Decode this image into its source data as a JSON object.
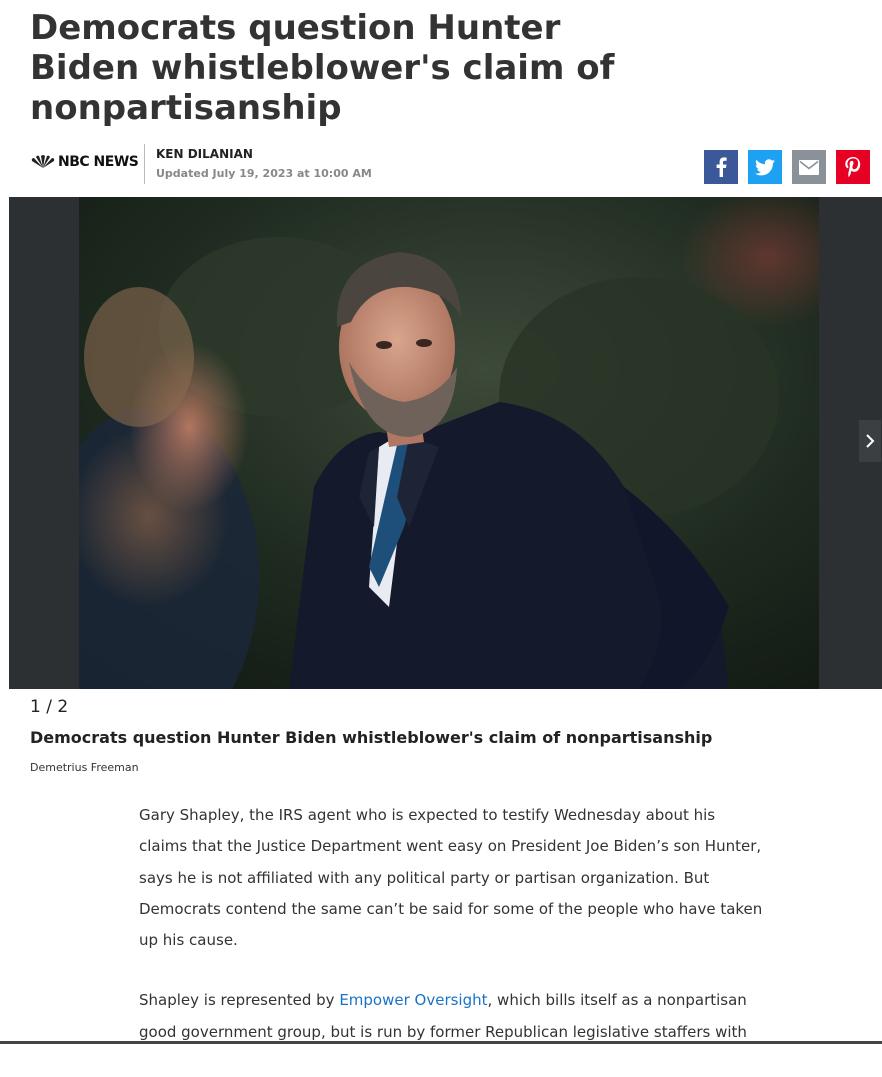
{
  "article": {
    "headline": "Democrats question Hunter Biden whistleblower's claim of nonpartisanship",
    "brand": "NBC NEWS",
    "author": "KEN DILANIAN",
    "updated": "Updated July 19, 2023 at 10:00 AM"
  },
  "share": {
    "facebook_icon": "facebook-icon",
    "twitter_icon": "twitter-icon",
    "email_icon": "email-icon",
    "pinterest_icon": "pinterest-icon"
  },
  "gallery": {
    "counter": "1 / 2",
    "caption": "Democrats question Hunter Biden whistleblower's claim of nonpartisanship",
    "credit": "Demetrius Freeman"
  },
  "body": {
    "p1": "Gary Shapley, the IRS agent who is expected to testify Wednesday about his claims that the Justice Department went easy on President Joe Biden’s son Hunter, says he is not affiliated with any political party or partisan organization. But Democrats contend the same can’t be said for some of the people who have taken up his cause.",
    "p2_start": "Shapley is represented by ",
    "p2_link": "Empower Oversight",
    "p2_end": ", which bills itself as a nonpartisan good government group, but is run by former Republican legislative staffers with"
  },
  "colors": {
    "facebook": "#3b5998",
    "twitter": "#1da1f2",
    "email": "#8a9199",
    "pinterest": "#e60023",
    "link": "#1a73c8"
  }
}
